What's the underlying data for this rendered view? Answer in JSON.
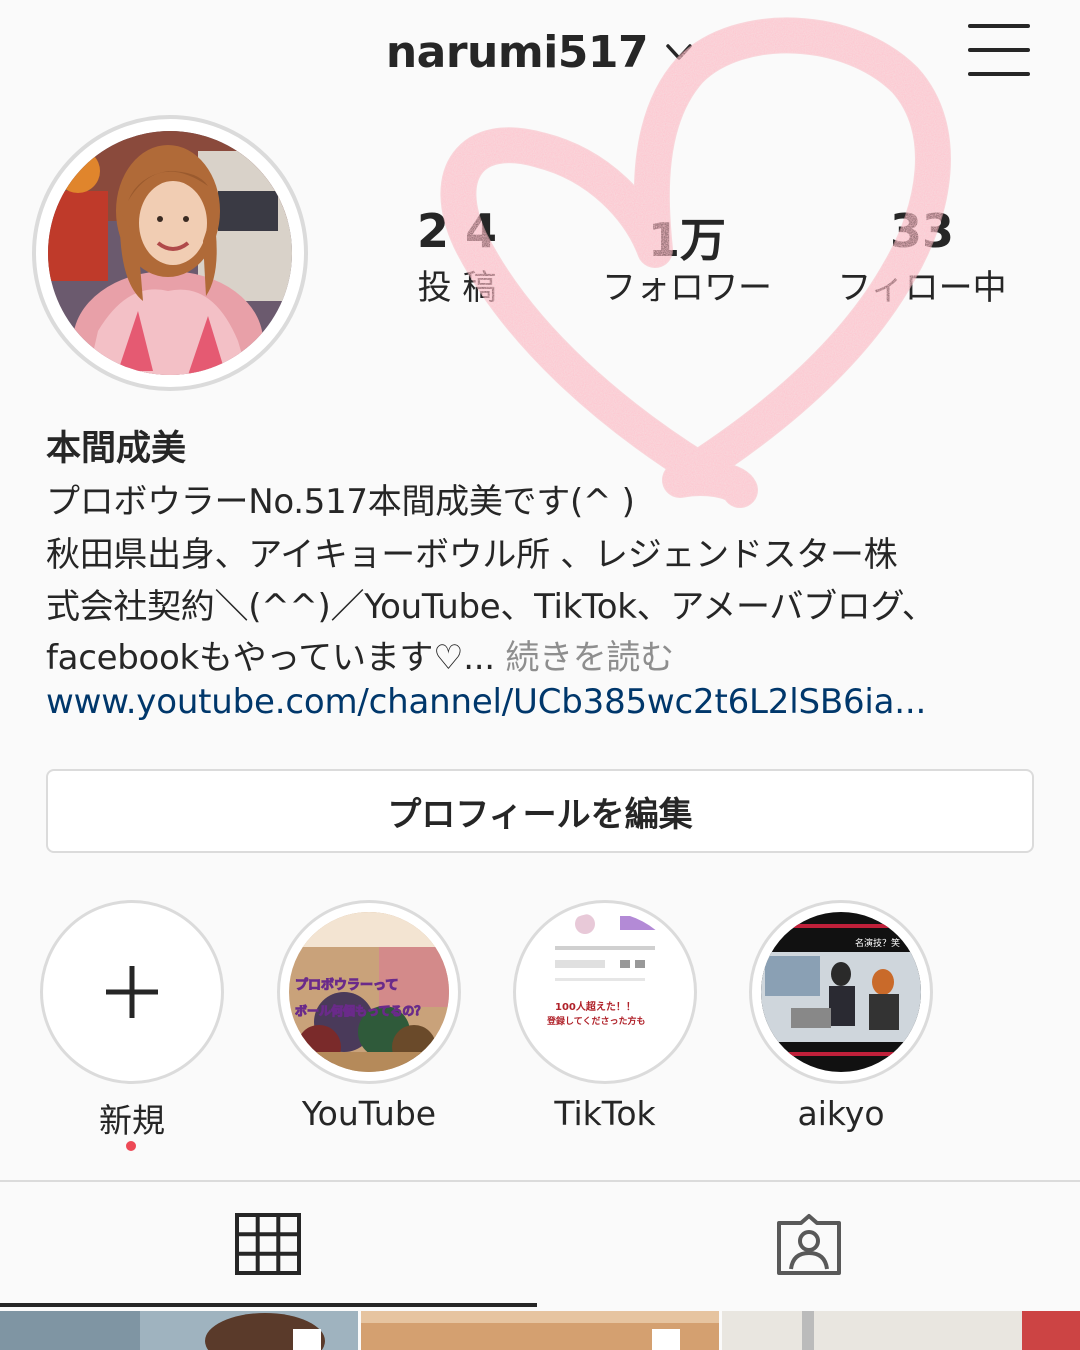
{
  "header": {
    "username": "narumi517",
    "chevron_icon": "chevron-down-icon",
    "menu_icon": "hamburger-menu-icon"
  },
  "stats": [
    {
      "value": "2 4",
      "label": "投 稿"
    },
    {
      "value": "1万",
      "label": "フォロワー"
    },
    {
      "value": "33",
      "label": "フィロー中"
    }
  ],
  "profile": {
    "name": "本間成美",
    "bio_lines": [
      "プロボウラーNo.517本間成美です(^ )",
      "秋田県出身、アイキョーボウル所 、レジェンドスター株",
      "式会社契約＼(^^)／YouTube、TikTok、アメーバブログ、",
      "facebookもやっています♡..."
    ],
    "more_label": "続きを読む",
    "url": "www.youtube.com/channel/UCb385wc2t6L2lSB6ia..."
  },
  "edit_profile_label": "プロフィールを編集",
  "highlights": [
    {
      "label": "新規",
      "icon": "plus-icon"
    },
    {
      "label": "YouTube",
      "thumb_text_top": "プロボウラーって",
      "thumb_text_bottom": "ボール何個もってるの？"
    },
    {
      "label": "TikTok",
      "thumb_text_top": "100人超えた！！",
      "thumb_text_bottom": "登録してくださった方も"
    },
    {
      "label": "aikyo",
      "thumb_text_top": "名演技？笑"
    }
  ],
  "tabs": {
    "grid_icon": "grid-icon",
    "tagged_icon": "tagged-person-icon"
  },
  "colors": {
    "background": "#fafafa",
    "text": "#262626",
    "link": "#00376b",
    "muted": "#8e8e8e",
    "border": "#dbdbdb",
    "notification_dot": "#ed4956",
    "heart_overlay": "#f08a9a"
  }
}
